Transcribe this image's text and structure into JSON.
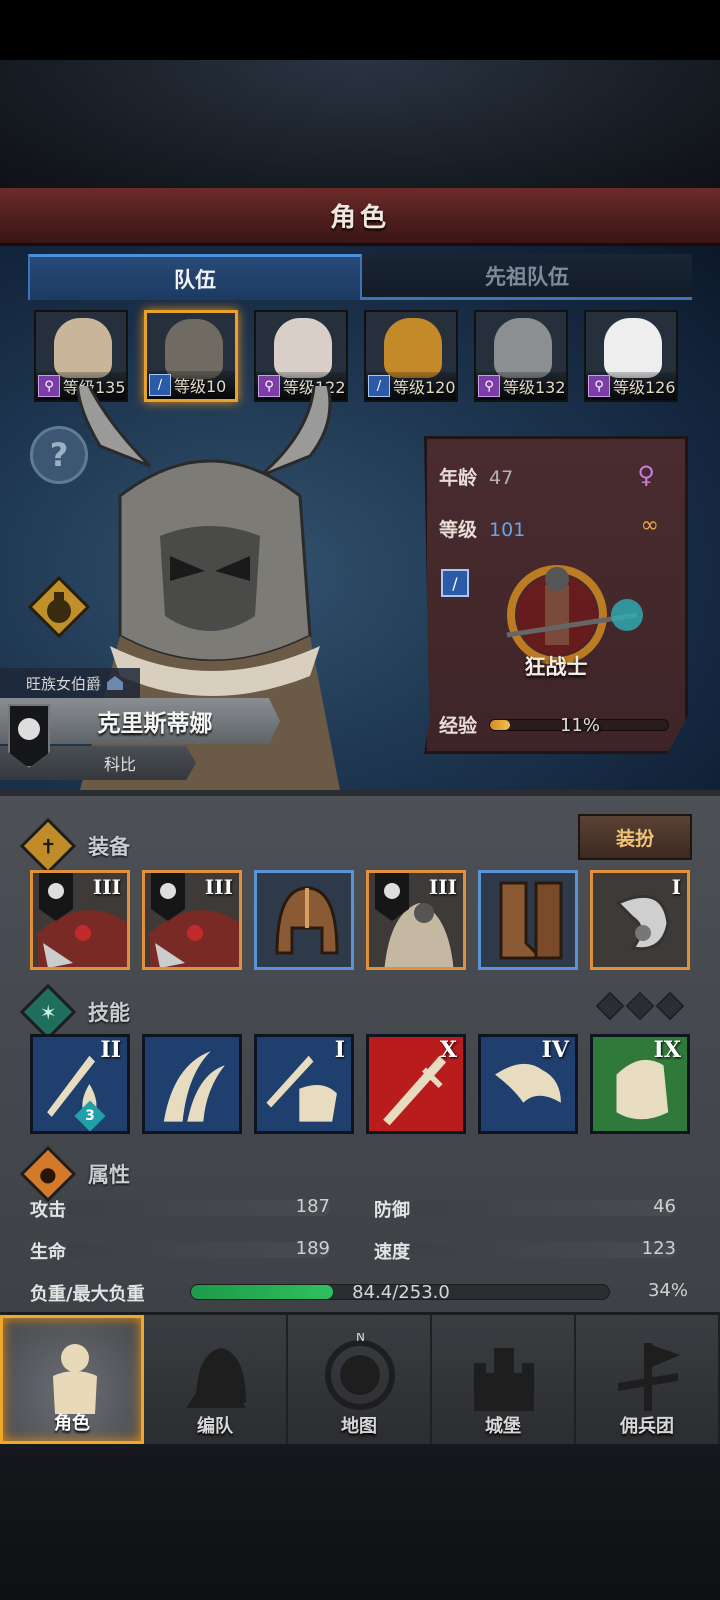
{
  "title": "角色",
  "tabs": [
    {
      "label": "队伍",
      "active": true
    },
    {
      "label": "先祖队伍",
      "active": false
    }
  ],
  "party": [
    {
      "level_text": "等级135",
      "class_icon": "staff-icon",
      "color": "#7b3ea6",
      "face_color": "#c9b59a",
      "selected": false
    },
    {
      "level_text": "等级10",
      "class_icon": "sword-icon",
      "color": "#2a5aa8",
      "face_color": "#6f6a62",
      "selected": true
    },
    {
      "level_text": "等级122",
      "class_icon": "staff-icon",
      "color": "#7b3ea6",
      "face_color": "#d9cfc8",
      "selected": false
    },
    {
      "level_text": "等级120",
      "class_icon": "sword-icon",
      "color": "#2a5aa8",
      "face_color": "#c48a2a",
      "selected": false
    },
    {
      "level_text": "等级132",
      "class_icon": "staff-icon",
      "color": "#7b3ea6",
      "face_color": "#8b8f92",
      "selected": false
    },
    {
      "level_text": "等级126",
      "class_icon": "staff-icon",
      "color": "#7b3ea6",
      "face_color": "#eeeeee",
      "selected": false
    }
  ],
  "hero": {
    "noble_title": "旺族女伯爵",
    "name": "克里斯蒂娜",
    "subtitle": "科比",
    "age_label": "年龄",
    "age": "47",
    "level_label": "等级",
    "level": "101",
    "class_name": "狂战士",
    "exp_label": "经验",
    "exp_percent": 11,
    "exp_text": "11%"
  },
  "equipment": {
    "label": "装备",
    "dress_button": "装扮",
    "slots": [
      {
        "name": "armor-slot",
        "tier": "III",
        "style": "orange",
        "banner": true
      },
      {
        "name": "armor-slot-2",
        "tier": "III",
        "style": "orange",
        "banner": true
      },
      {
        "name": "helmet-slot",
        "tier": "",
        "style": "blue",
        "banner": false
      },
      {
        "name": "cloak-slot",
        "tier": "III",
        "style": "orange",
        "banner": true
      },
      {
        "name": "boots-slot",
        "tier": "",
        "style": "blue",
        "banner": false
      },
      {
        "name": "trinket-slot",
        "tier": "I",
        "style": "orange",
        "banner": false
      }
    ]
  },
  "skills": {
    "label": "技能",
    "items": [
      {
        "name": "skill-sword-drop",
        "roman": "II",
        "bg": "#1f3f6e",
        "stack": "3"
      },
      {
        "name": "skill-claw",
        "roman": "",
        "bg": "#1f3f6e",
        "stack": ""
      },
      {
        "name": "skill-sword-fist",
        "roman": "I",
        "bg": "#1f3f6e",
        "stack": ""
      },
      {
        "name": "skill-red-sword",
        "roman": "X",
        "bg": "#b81c1c",
        "stack": ""
      },
      {
        "name": "skill-eagle",
        "roman": "IV",
        "bg": "#1f3f6e",
        "stack": ""
      },
      {
        "name": "skill-green-fist",
        "roman": "IX",
        "bg": "#2f7a3a",
        "stack": ""
      }
    ]
  },
  "attributes": {
    "label": "属性",
    "attack_label": "攻击",
    "attack": "187",
    "defense_label": "防御",
    "defense": "46",
    "hp_label": "生命",
    "hp": "189",
    "speed_label": "速度",
    "speed": "123",
    "load_label": "负重/最大负重",
    "load_text": "84.4/253.0",
    "load_percent": 34,
    "load_percent_text": "34%"
  },
  "nav": [
    {
      "label": "角色",
      "icon": "knight-icon",
      "active": true
    },
    {
      "label": "编队",
      "icon": "helmet-formation-icon",
      "active": false
    },
    {
      "label": "地图",
      "icon": "compass-map-icon",
      "active": false
    },
    {
      "label": "城堡",
      "icon": "castle-icon",
      "active": false
    },
    {
      "label": "佣兵团",
      "icon": "mercenary-banner-icon",
      "active": false
    }
  ]
}
